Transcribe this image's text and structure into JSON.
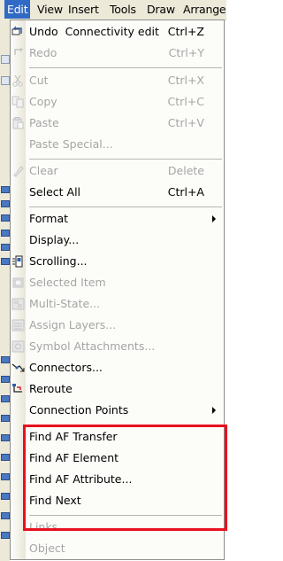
{
  "menubar": {
    "items": [
      "Edit",
      "View",
      "Insert",
      "Tools",
      "Draw",
      "Arrange"
    ],
    "active": "Edit"
  },
  "menu": {
    "undo": {
      "label": "Undo  Connectivity edit",
      "shortcut": "Ctrl+Z"
    },
    "redo": {
      "label": "Redo",
      "shortcut": "Ctrl+Y"
    },
    "cut": {
      "label": "Cut",
      "shortcut": "Ctrl+X"
    },
    "copy": {
      "label": "Copy",
      "shortcut": "Ctrl+C"
    },
    "paste": {
      "label": "Paste",
      "shortcut": "Ctrl+V"
    },
    "paste_special": {
      "label": "Paste Special..."
    },
    "clear": {
      "label": "Clear",
      "shortcut": "Delete"
    },
    "select_all": {
      "label": "Select All",
      "shortcut": "Ctrl+A"
    },
    "format": {
      "label": "Format"
    },
    "display": {
      "label": "Display..."
    },
    "scrolling": {
      "label": "Scrolling..."
    },
    "selected_item": {
      "label": "Selected Item"
    },
    "multi_state": {
      "label": "Multi-State..."
    },
    "assign_layers": {
      "label": "Assign Layers..."
    },
    "symbol_attachments": {
      "label": "Symbol Attachments..."
    },
    "connectors": {
      "label": "Connectors..."
    },
    "reroute": {
      "label": "Reroute"
    },
    "connection_points": {
      "label": "Connection Points"
    },
    "find_af_transfer": {
      "label": "Find AF Transfer"
    },
    "find_af_element": {
      "label": "Find AF Element"
    },
    "find_af_attribute": {
      "label": "Find AF Attribute..."
    },
    "find_next": {
      "label": "Find Next"
    },
    "links": {
      "label": "Links..."
    },
    "object": {
      "label": "Object"
    }
  },
  "colors": {
    "highlight_box": "#e8101e",
    "menu_selection": "#316ac5",
    "disabled_text": "#a5a5a5"
  },
  "icons": [
    "undo-icon",
    "redo-icon",
    "cut-icon",
    "copy-icon",
    "paste-icon",
    "clear-icon",
    "scrolling-icon",
    "selected-item-icon",
    "multi-state-icon",
    "assign-layers-icon",
    "symbol-attachments-icon",
    "connectors-icon",
    "reroute-icon"
  ]
}
